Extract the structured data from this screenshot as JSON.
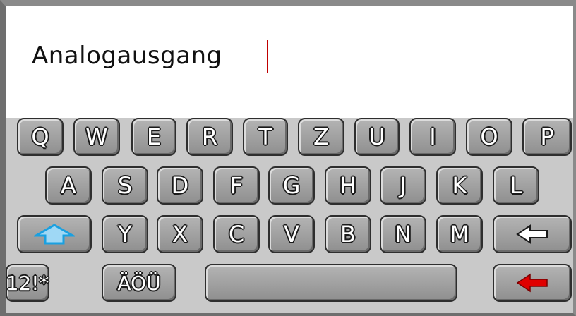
{
  "input": {
    "value": "Analogausgang"
  },
  "keyboard": {
    "row1": [
      "Q",
      "W",
      "E",
      "R",
      "T",
      "Z",
      "U",
      "I",
      "O",
      "P"
    ],
    "row2": [
      "A",
      "S",
      "D",
      "F",
      "G",
      "H",
      "J",
      "K",
      "L"
    ],
    "row3": [
      "Y",
      "X",
      "C",
      "V",
      "B",
      "N",
      "M"
    ],
    "numbers_label": "12!*",
    "umlaut_label": "ÄÖÜ",
    "shift_icon": "shift-up-arrow-icon",
    "backspace_icon": "left-arrow-icon",
    "enter_icon": "red-left-arrow-icon",
    "colors": {
      "accent_shift": "#1aa0e0",
      "accent_enter": "#e00000",
      "cursor": "#c00000"
    }
  }
}
